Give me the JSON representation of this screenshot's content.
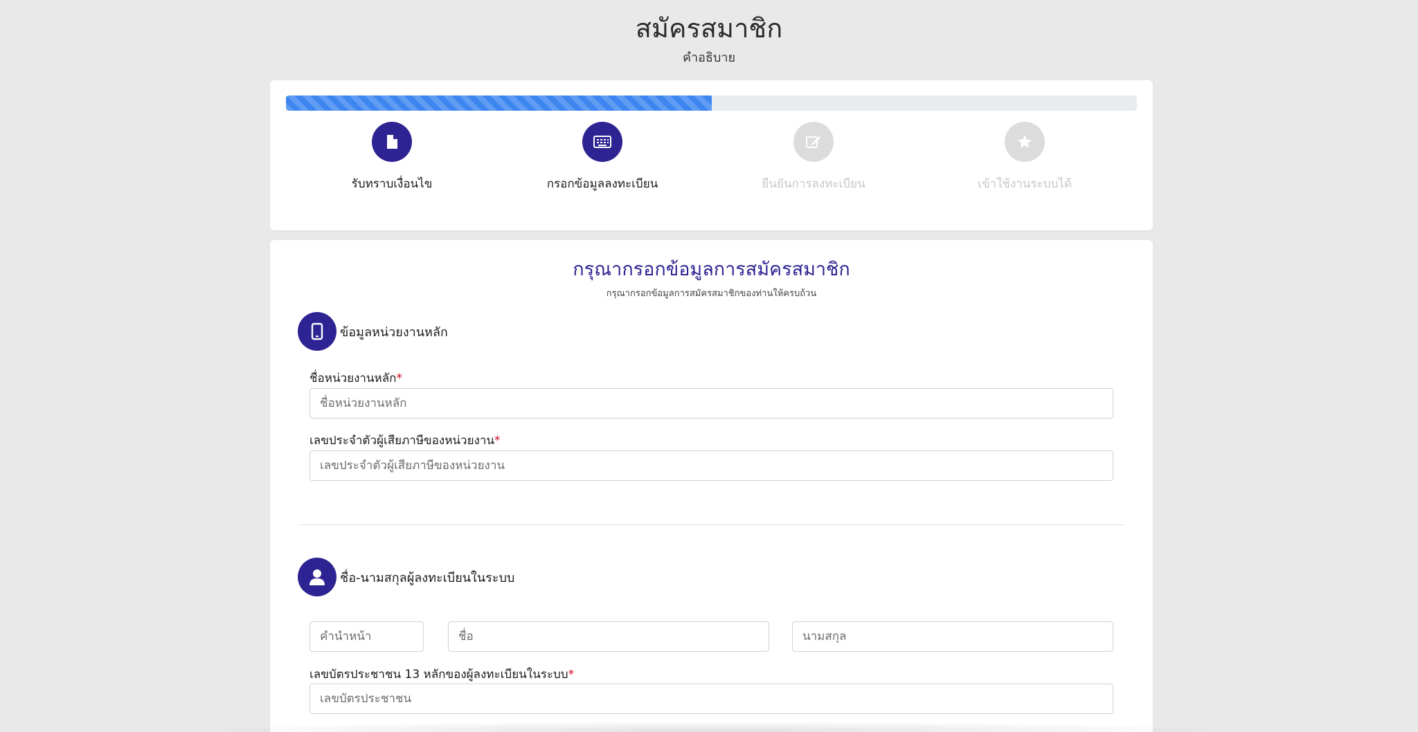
{
  "header": {
    "title": "สมัครสมาชิก",
    "subtitle": "คำอธิบาย"
  },
  "progress": {
    "percent": 50,
    "steps": [
      {
        "label": "รับทราบเงื่อนไข",
        "icon": "file-icon",
        "state": "done"
      },
      {
        "label": "กรอกข้อมูลลงทะเบียน",
        "icon": "keyboard-icon",
        "state": "current"
      },
      {
        "label": "ยืนยันการลงทะเบียน",
        "icon": "edit-icon",
        "state": "pending"
      },
      {
        "label": "เข้าใช้งานระบบได้",
        "icon": "star-icon",
        "state": "pending"
      }
    ]
  },
  "form": {
    "title": "กรุณากรอกข้อมูลการสมัครสมาชิก",
    "subtitle": "กรุณากรอกข้อมูลการสมัครสมาชิกของท่านให้ครบถ้วน",
    "section_org": {
      "label": "ข้อมูลหน่วยงานหลัก",
      "icon": "tablet-icon",
      "org_name_label": "ชื่อหน่วยงานหลัก",
      "org_name_placeholder": "ชื่อหน่วยงานหลัก",
      "tax_id_label": "เลขประจำตัวผู้เสียภาษีของหน่วยงาน",
      "tax_id_placeholder": "เลขประจำตัวผู้เสียภาษีของหน่วยงาน"
    },
    "section_person": {
      "label": "ชื่อ-นามสกุลผู้ลงทะเบียนในระบบ",
      "icon": "user-icon",
      "prefix_placeholder": "คำนำหน้า",
      "first_name_placeholder": "ชื่อ",
      "last_name_placeholder": "นามสกุล",
      "id_card_label": "เลขบัตรประชาชน 13 หลักของผู้ลงทะเบียนในระบบ",
      "id_card_placeholder": "เลขบัตรประชาชน"
    },
    "required_mark": "*"
  },
  "colors": {
    "primary": "#2e2392",
    "progress": "#3d86f0",
    "required": "#d0021b",
    "inactive": "#dcdcdc"
  }
}
